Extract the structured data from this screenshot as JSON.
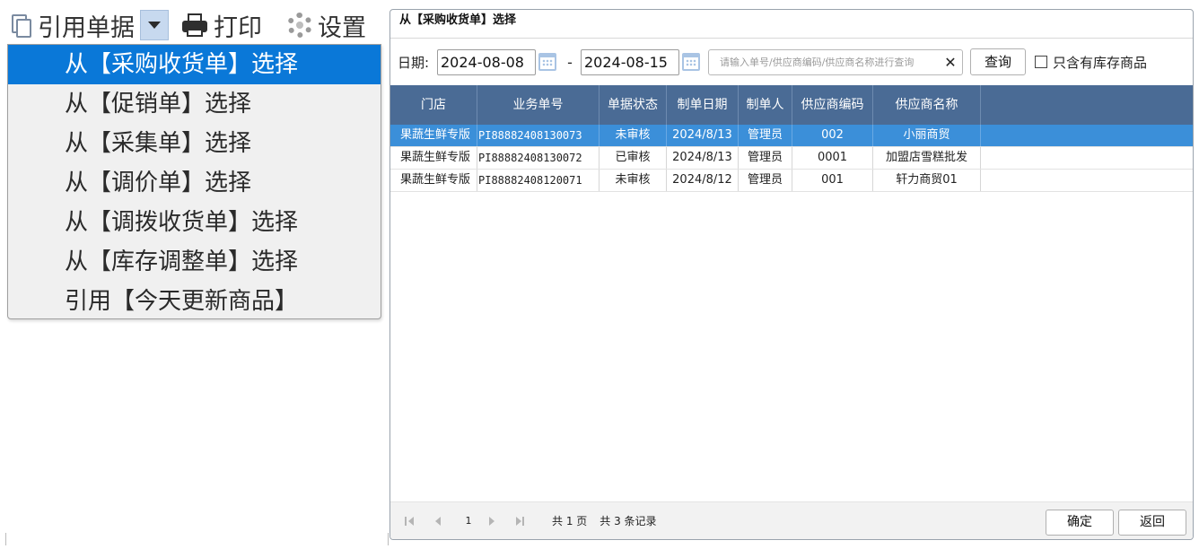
{
  "toolbar": {
    "reference_label": "引用单据",
    "print_label": "打印",
    "settings_label": "设置"
  },
  "menu": {
    "items": [
      {
        "label": "从【采购收货单】选择",
        "active": true
      },
      {
        "label": "从【促销单】选择",
        "active": false
      },
      {
        "label": "从【采集单】选择",
        "active": false
      },
      {
        "label": "从【调价单】选择",
        "active": false
      },
      {
        "label": "从【调拨收货单】选择",
        "active": false
      },
      {
        "label": "从【库存调整单】选择",
        "active": false
      },
      {
        "label": "引用【今天更新商品】",
        "active": false
      }
    ]
  },
  "dialog": {
    "title": "从【采购收货单】选择",
    "filter": {
      "date_label": "日期:",
      "date_from": "2024-08-08",
      "separator": "-",
      "date_to": "2024-08-15",
      "search_placeholder": "请输入单号/供应商编码/供应商名称进行查询",
      "clear_symbol": "✕",
      "query_label": "查询",
      "stock_only_label": "只含有库存商品",
      "stock_only_checked": false
    },
    "table": {
      "columns": [
        "门店",
        "业务单号",
        "单据状态",
        "制单日期",
        "制单人",
        "供应商编码",
        "供应商名称"
      ],
      "rows": [
        [
          "果蔬生鲜专版",
          "PI88882408130073",
          "未审核",
          "2024/8/13",
          "管理员",
          "002",
          "小丽商贸"
        ],
        [
          "果蔬生鲜专版",
          "PI88882408130072",
          "已审核",
          "2024/8/13",
          "管理员",
          "0001",
          "加盟店雪糕批发"
        ],
        [
          "果蔬生鲜专版",
          "PI88882408120071",
          "未审核",
          "2024/8/12",
          "管理员",
          "001",
          "轩力商贸01"
        ]
      ],
      "selected_row": 0
    },
    "pager": {
      "current_page": "1",
      "total_pages_text": "共 1 页",
      "total_records_text": "共 3 条记录"
    },
    "buttons": {
      "ok_label": "确定",
      "back_label": "返回"
    }
  },
  "colors": {
    "menu_active": "#0a78d8",
    "grid_header": "#4a6b95",
    "row_selected": "#3b8fd9"
  }
}
